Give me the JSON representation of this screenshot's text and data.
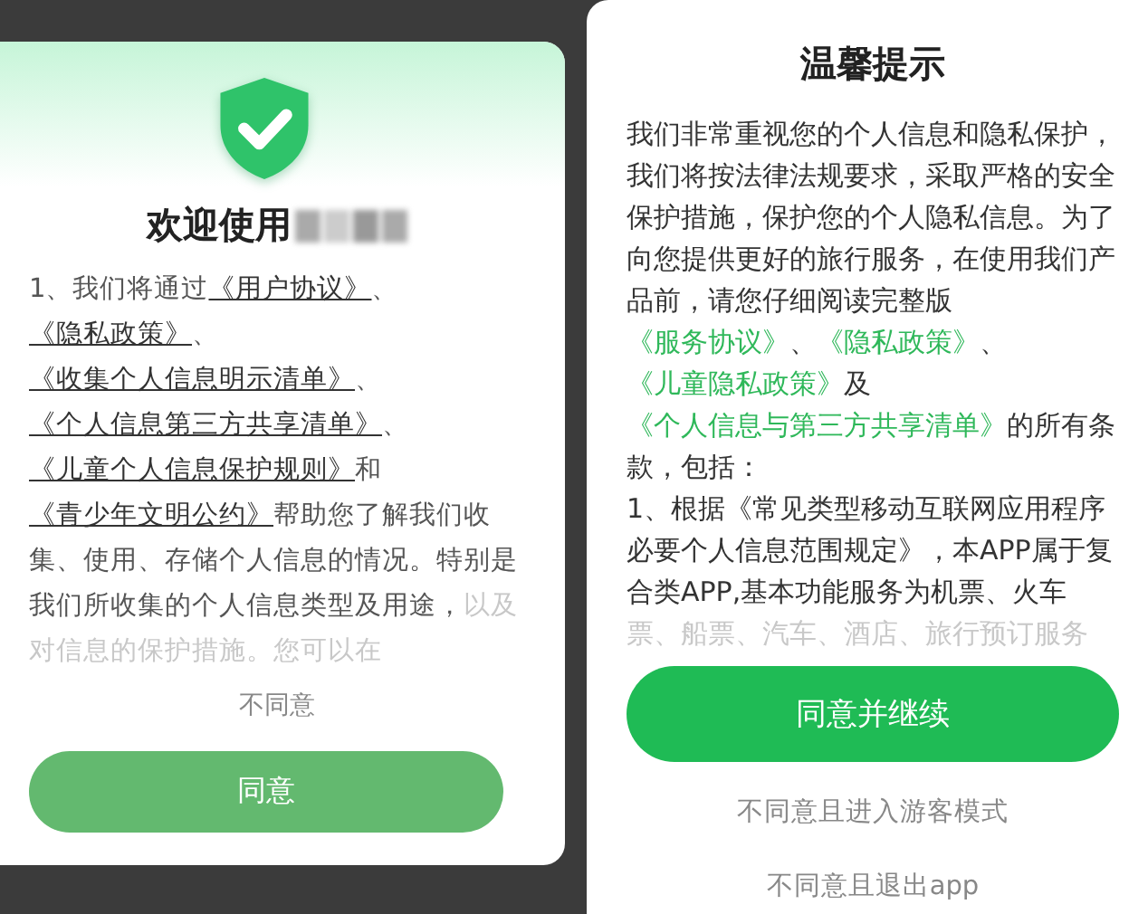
{
  "welcome_dialog": {
    "title": "欢迎使用",
    "body": [
      {
        "kind": "text",
        "text": "1、我们将通过"
      },
      {
        "kind": "link",
        "text": "《用户协议》"
      },
      {
        "kind": "text",
        "text": "、"
      },
      {
        "kind": "link",
        "text": "《隐私政策》"
      },
      {
        "kind": "text",
        "text": "、"
      },
      {
        "kind": "link",
        "text": "《收集个人信息明示清单》"
      },
      {
        "kind": "text",
        "text": "、"
      },
      {
        "kind": "link",
        "text": "《个人信息第三方共享清单》"
      },
      {
        "kind": "text",
        "text": "、"
      },
      {
        "kind": "link",
        "text": "《儿童个人信息保护规则》"
      },
      {
        "kind": "text",
        "text": "和"
      },
      {
        "kind": "link",
        "text": "《青少年文明公约》"
      },
      {
        "kind": "text",
        "text": "帮助您了解我们收集、使用、存储个人信息的情况。特别是我们所收集的个人信息类型及用途，"
      },
      {
        "kind": "faded",
        "text": "以及对信息的保护措施。您可以在"
      }
    ],
    "decline": "不同意",
    "accept": "同意"
  },
  "notice_dialog": {
    "title": "温馨提示",
    "paragraphs": [
      [
        {
          "kind": "text",
          "text": "我们非常重视您的个人信息和隐私保护，我们将按法律法规要求，采取严格的安全保护措施，保护您的个人隐私信息。为了向您提供更好的旅行服务，在使用我们产品前，请您仔细阅读完整版"
        },
        {
          "kind": "link",
          "text": "《服务协议》"
        },
        {
          "kind": "text",
          "text": "、"
        },
        {
          "kind": "link",
          "text": "《隐私政策》"
        },
        {
          "kind": "text",
          "text": "、"
        },
        {
          "kind": "link",
          "text": "《儿童隐私政策》"
        },
        {
          "kind": "text",
          "text": "及"
        },
        {
          "kind": "link",
          "text": "《个人信息与第三方共享清单》"
        },
        {
          "kind": "text",
          "text": "的所有条款，包括："
        }
      ],
      [
        {
          "kind": "text",
          "text": "1、根据《常见类型移动互联网应用程序必要个人信息范围规定》，本APP属于复合类APP,基本功能服务为机票、火车"
        },
        {
          "kind": "faded",
          "text": "票、船票、汽车、酒店、旅行预订服务"
        }
      ]
    ],
    "accept": "同意并继续",
    "guest": "不同意且进入游客模式",
    "exit": "不同意且退出app"
  }
}
